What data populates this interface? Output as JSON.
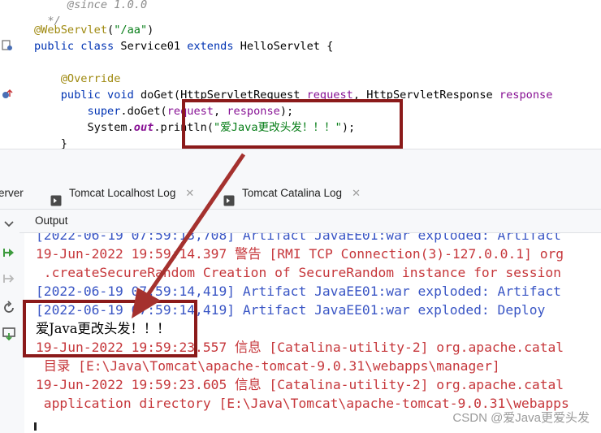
{
  "editor": {
    "lines": [
      {
        "parts": [
          {
            "t": "     @since 1.0.0",
            "c": "c-comment"
          }
        ]
      },
      {
        "parts": [
          {
            "t": "  */",
            "c": "c-comment"
          }
        ]
      },
      {
        "parts": [
          {
            "t": "@WebServlet",
            "c": "c-anno"
          },
          {
            "t": "(",
            "c": "c-plain"
          },
          {
            "t": "\"/aa\"",
            "c": "c-str"
          },
          {
            "t": ")",
            "c": "c-plain"
          }
        ]
      },
      {
        "parts": [
          {
            "t": "public class ",
            "c": "c-kw"
          },
          {
            "t": "Service01 ",
            "c": "c-type"
          },
          {
            "t": "extends ",
            "c": "c-kw"
          },
          {
            "t": "HelloServlet {",
            "c": "c-type"
          }
        ]
      },
      {
        "parts": [
          {
            "t": "",
            "c": "c-plain"
          }
        ]
      },
      {
        "parts": [
          {
            "t": "    @Override",
            "c": "c-anno"
          }
        ]
      },
      {
        "parts": [
          {
            "t": "    public void ",
            "c": "c-kw"
          },
          {
            "t": "doGet(",
            "c": "c-plain"
          },
          {
            "t": "HttpServletRequest ",
            "c": "c-type"
          },
          {
            "t": "request",
            "c": "c-param"
          },
          {
            "t": ", ",
            "c": "c-plain"
          },
          {
            "t": "HttpServletResponse ",
            "c": "c-type"
          },
          {
            "t": "response",
            "c": "c-param"
          }
        ]
      },
      {
        "parts": [
          {
            "t": "        super",
            "c": "c-kw"
          },
          {
            "t": ".doGet(",
            "c": "c-plain"
          },
          {
            "t": "request",
            "c": "c-param"
          },
          {
            "t": ", ",
            "c": "c-plain"
          },
          {
            "t": "response",
            "c": "c-param"
          },
          {
            "t": ");",
            "c": "c-plain"
          }
        ]
      },
      {
        "parts": [
          {
            "t": "        System.",
            "c": "c-plain"
          },
          {
            "t": "out",
            "c": "c-field"
          },
          {
            "t": ".",
            "c": "c-plain"
          },
          {
            "t": "println",
            "c": "c-plain"
          },
          {
            "t": "(",
            "c": "c-plain"
          },
          {
            "t": "\"爱Java更改头发！！！\"",
            "c": "c-str"
          },
          {
            "t": ");",
            "c": "c-plain"
          }
        ]
      },
      {
        "parts": [
          {
            "t": "    }",
            "c": "c-plain"
          }
        ]
      }
    ]
  },
  "tabs": [
    {
      "label": "erver",
      "closable": false
    },
    {
      "label": "Tomcat Localhost Log",
      "closable": true
    },
    {
      "label": "Tomcat Catalina Log",
      "closable": true
    }
  ],
  "output": {
    "title": "Output",
    "lines": [
      {
        "text": "[2022-06-19 07:59:13,708] Artifact JavaEE01:war exploded: Artifact",
        "color": "blue"
      },
      {
        "text": "19-Jun-2022 19:59:14.397 警告 [RMI TCP Connection(3)-127.0.0.1] org",
        "color": "red"
      },
      {
        "text": " .createSecureRandom Creation of SecureRandom instance for session",
        "color": "red"
      },
      {
        "text": "[2022-06-19 07:59:14,419] Artifact JavaEE01:war exploded: Artifact",
        "color": "blue"
      },
      {
        "text": "[2022-06-19 07:59:14,419] Artifact JavaEE01:war exploded: Deploy",
        "color": "blue"
      },
      {
        "text": "爱Java更改头发！！！",
        "color": "black"
      },
      {
        "text": "19-Jun-2022 19:59:23.557 信息 [Catalina-utility-2] org.apache.catal",
        "color": "red"
      },
      {
        "text": " 目录 [E:\\Java\\Tomcat\\apache-tomcat-9.0.31\\webapps\\manager]",
        "color": "red"
      },
      {
        "text": "19-Jun-2022 19:59:23.605 信息 [Catalina-utility-2] org.apache.catal",
        "color": "red"
      },
      {
        "text": " application directory [E:\\Java\\Tomcat\\apache-tomcat-9.0.31\\webapps",
        "color": "red"
      }
    ]
  },
  "colors": {
    "annotation": "#8b1a1a",
    "console_red": "#c6373b",
    "console_blue": "#3a56c5"
  },
  "icons": [
    "servlet-gutter-icon",
    "override-gutter-icon",
    "tomcat-log-icon",
    "chevron-down-icon",
    "rerun-icon",
    "stop-icon",
    "restore-icon",
    "export-icon",
    "close-icon"
  ],
  "watermark": "CSDN @爱Java更爱头发"
}
